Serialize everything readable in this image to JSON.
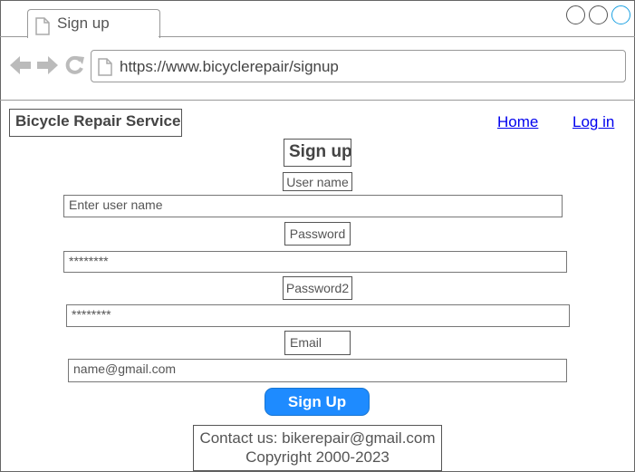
{
  "browser": {
    "tab_title": "Sign up",
    "url": "https://www.bicyclerepair/signup",
    "window_buttons": [
      "minimize-circle",
      "maximize-circle",
      "close-circle"
    ],
    "accent_color": "#1ba1e2"
  },
  "header": {
    "brand": "Bicycle Repair Service",
    "nav": {
      "home": "Home",
      "login": "Log in"
    }
  },
  "form": {
    "title": "Sign up",
    "username": {
      "label": "User name",
      "placeholder": "Enter user name"
    },
    "password": {
      "label": "Password",
      "value": "********"
    },
    "password2": {
      "label": "Password2",
      "value": "********"
    },
    "email": {
      "label": "Email",
      "value": "name@gmail.com"
    },
    "submit_label": "Sign Up",
    "button_color": "#1e8bff"
  },
  "footer": {
    "contact": "Contact us: bikerepair@gmail.com",
    "copyright": "Copyright 2000-2023"
  }
}
